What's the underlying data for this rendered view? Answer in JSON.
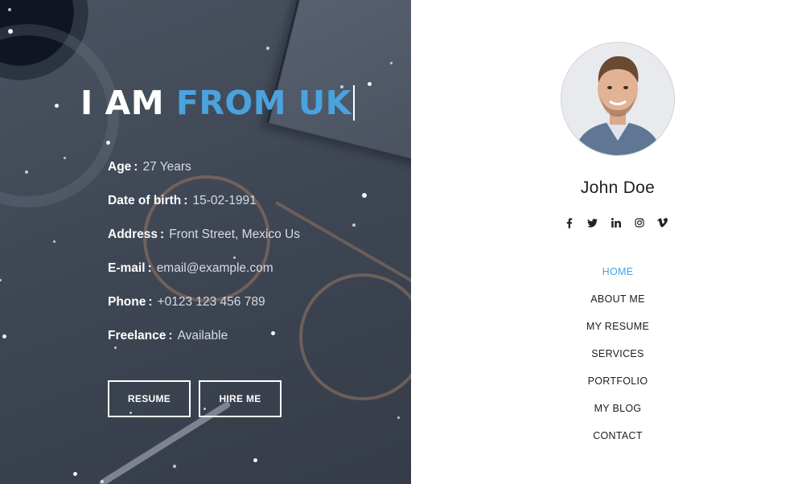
{
  "hero": {
    "title_prefix": "I AM",
    "title_highlight": "FROM UK",
    "accent_color": "#4aa3df",
    "info": [
      {
        "label": "Age",
        "value": "27 Years"
      },
      {
        "label": "Date of birth",
        "value": "15-02-1991"
      },
      {
        "label": "Address",
        "value": "Front Street, Mexico Us"
      },
      {
        "label": "E-mail",
        "value": "email@example.com"
      },
      {
        "label": "Phone",
        "value": "+0123 123 456 789"
      },
      {
        "label": "Freelance",
        "value": "Available"
      }
    ],
    "buttons": {
      "resume": "RESUME",
      "hire": "HIRE ME"
    }
  },
  "sidebar": {
    "name": "John Doe",
    "socials": [
      "facebook-icon",
      "twitter-icon",
      "linkedin-icon",
      "instagram-icon",
      "vimeo-icon"
    ],
    "nav": [
      {
        "label": "HOME",
        "active": true
      },
      {
        "label": "ABOUT ME"
      },
      {
        "label": "MY RESUME"
      },
      {
        "label": "SERVICES"
      },
      {
        "label": "PORTFOLIO"
      },
      {
        "label": "MY BLOG"
      },
      {
        "label": "CONTACT"
      }
    ]
  }
}
